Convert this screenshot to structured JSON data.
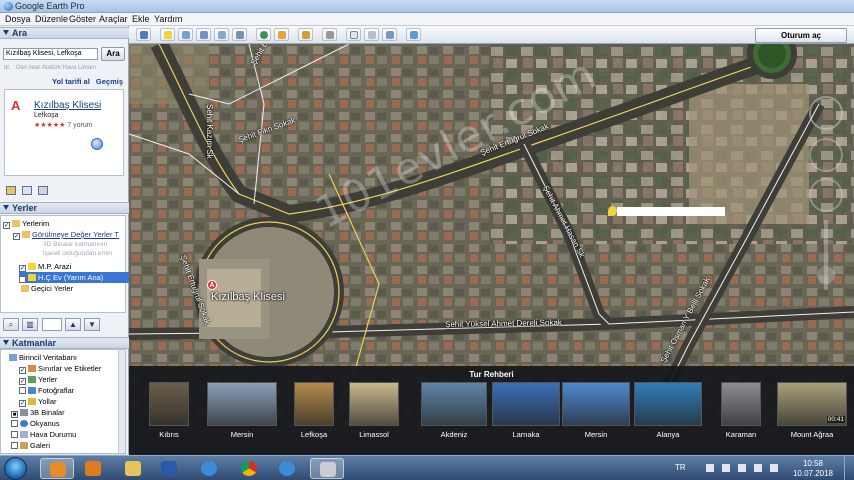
{
  "window": {
    "title": "Google Earth Pro"
  },
  "menu": [
    "Dosya",
    "Düzenle",
    "Göster",
    "Araçlar",
    "Ekle",
    "Yardım"
  ],
  "search": {
    "header": "Ara",
    "value": "Kızılbaş Klisesi, Lefkoşa",
    "button": "Ara",
    "hint": "dr. : Otel near Atatürk Hava Limanı",
    "links": [
      "Yol tarifi al",
      "Geçmiş"
    ],
    "result": {
      "name": "Kızılbaş Klisesi",
      "city": "Lefkoşa",
      "stars": "★★★★★",
      "reviews": "7 yorum"
    }
  },
  "places": {
    "header": "Yerler",
    "items": [
      {
        "label": "Yerlerim"
      },
      {
        "label": "Görülmeye Değer Yerler T"
      },
      {
        "label": "3D Binalar katmanının"
      },
      {
        "label": "işareti olduğundan emin"
      },
      {
        "label": "M.P. Arazi"
      },
      {
        "label": "H.Ç Ev (Yarım Ana)"
      },
      {
        "label": "Geçici Yerler"
      }
    ]
  },
  "layers": {
    "header": "Katmanlar",
    "items": [
      {
        "label": "Birincil Veritabanı"
      },
      {
        "label": "Sınırlar ve Etiketler"
      },
      {
        "label": "Yerler"
      },
      {
        "label": "Fotoğraflar"
      },
      {
        "label": "Yollar"
      },
      {
        "label": "3B Binalar"
      },
      {
        "label": "Okyanus"
      },
      {
        "label": "Hava Durumu"
      },
      {
        "label": "Galeri"
      }
    ]
  },
  "toolbar": {
    "signin": "Oturum aç"
  },
  "map": {
    "labels": {
      "church": "Kızılbaş Klisesi",
      "road1": "Şehit Ertuğrul Sokak",
      "road2": "Şehit Yüksel Ahmet Dereli Sokak",
      "road3": "Şehit Ahmet Hasan Sk",
      "road4": "Şehit Ertuğrul Sokak",
      "road5": "Şehit Kazım Sk",
      "road6": "Şehit Osman Y Belli Sokak",
      "road7": "Şehit Ertuğrul Sokak",
      "road8": "Şehit Fikri Sokak"
    },
    "watermark": "101evler.com"
  },
  "tour": {
    "title": "Tur Rehberi",
    "cards": [
      {
        "label": "Kıbrıs",
        "color": "#6b5e4a"
      },
      {
        "label": "Mersin",
        "color": "#8aa0b8"
      },
      {
        "label": "Lefkoşa",
        "color": "#b38a4a"
      },
      {
        "label": "Limassol",
        "color": "#c9b88e"
      },
      {
        "label": "Akdeniz",
        "color": "#5f86a8"
      },
      {
        "label": "Larnaka",
        "color": "#3b6fb7"
      },
      {
        "label": "Mersin",
        "color": "#4e88d0"
      },
      {
        "label": "Alanya",
        "color": "#2f7fb8"
      },
      {
        "label": "Karaman",
        "color": "#8b8e93"
      },
      {
        "label": "Mount Ağraa",
        "color": "#a8a07a"
      }
    ],
    "duration": "00:41"
  },
  "taskbar": {
    "language": "TR",
    "time": "10:58",
    "date": "10.07.2018",
    "apps": [
      "outlook",
      "media",
      "explorer",
      "word",
      "ie",
      "chrome",
      "ie2",
      "earth"
    ]
  }
}
